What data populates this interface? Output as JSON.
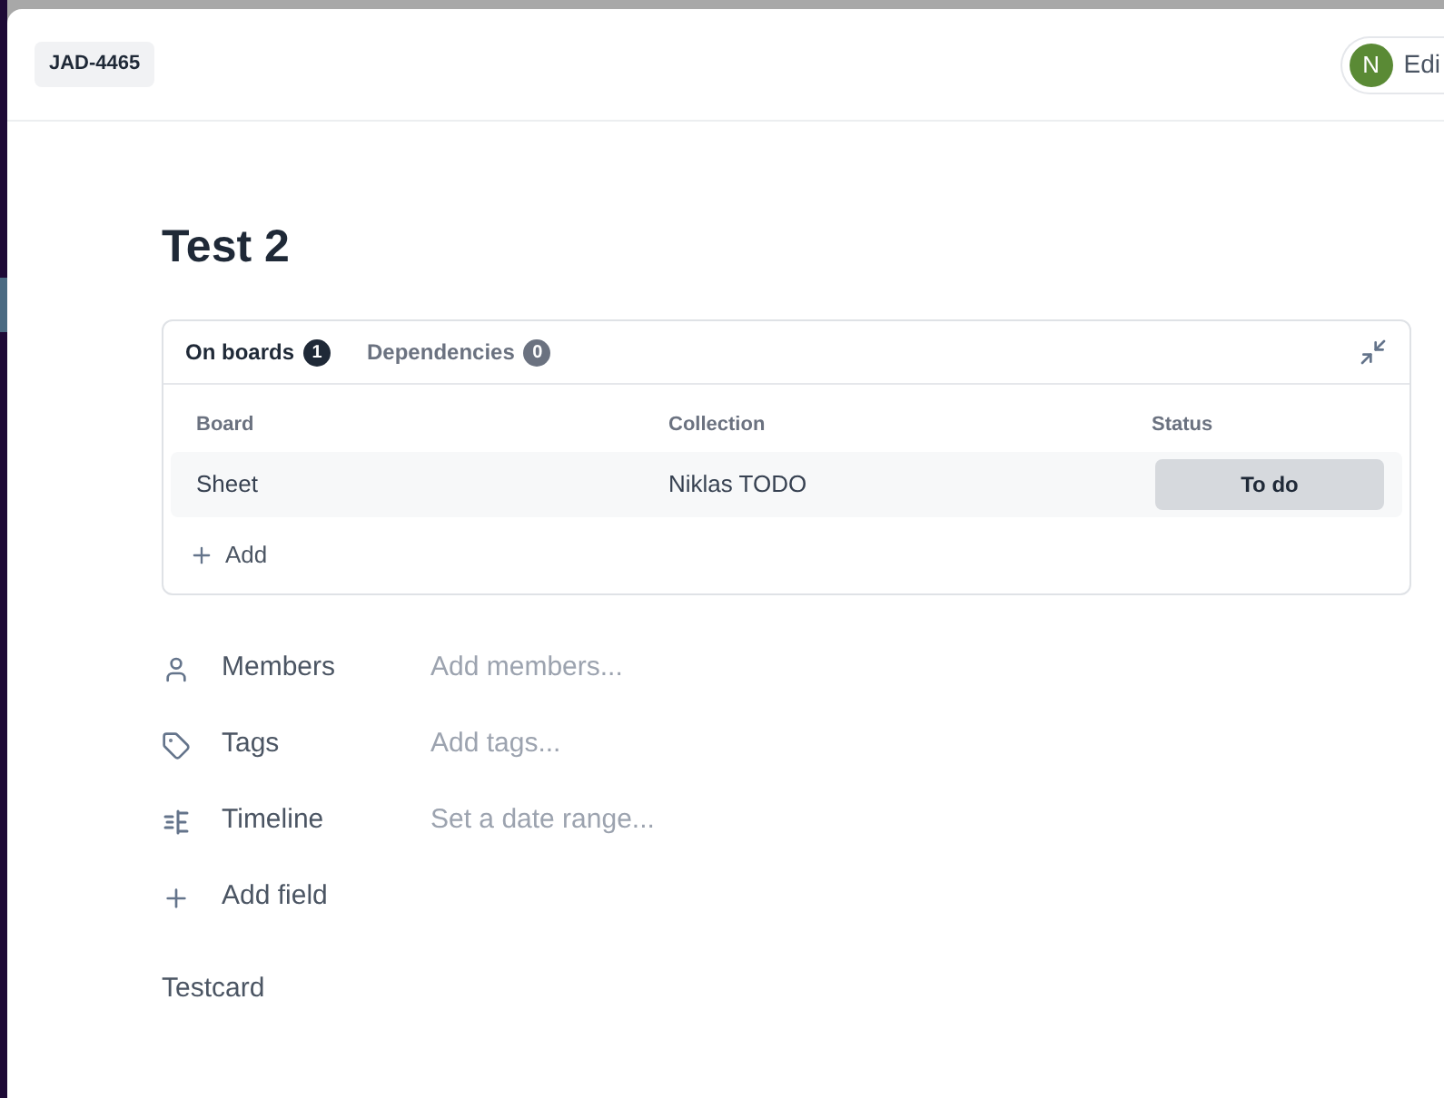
{
  "card_id": "JAD-4465",
  "editor": {
    "initial": "N",
    "label": "Edi"
  },
  "title": "Test 2",
  "tabs": [
    {
      "label": "On boards",
      "count": "1",
      "selected": true
    },
    {
      "label": "Dependencies",
      "count": "0",
      "selected": false
    }
  ],
  "table": {
    "columns": [
      "Board",
      "Collection",
      "Status"
    ],
    "rows": [
      {
        "board": "Sheet",
        "collection": "Niklas TODO",
        "status": "To do"
      }
    ]
  },
  "add_row": "Add",
  "fields": [
    {
      "kind": "members",
      "label": "Members",
      "placeholder": "Add members..."
    },
    {
      "kind": "tags",
      "label": "Tags",
      "placeholder": "Add tags..."
    },
    {
      "kind": "timeline",
      "label": "Timeline",
      "placeholder": "Set a date range..."
    },
    {
      "kind": "add",
      "label": "Add field"
    }
  ],
  "description": "Testcard"
}
